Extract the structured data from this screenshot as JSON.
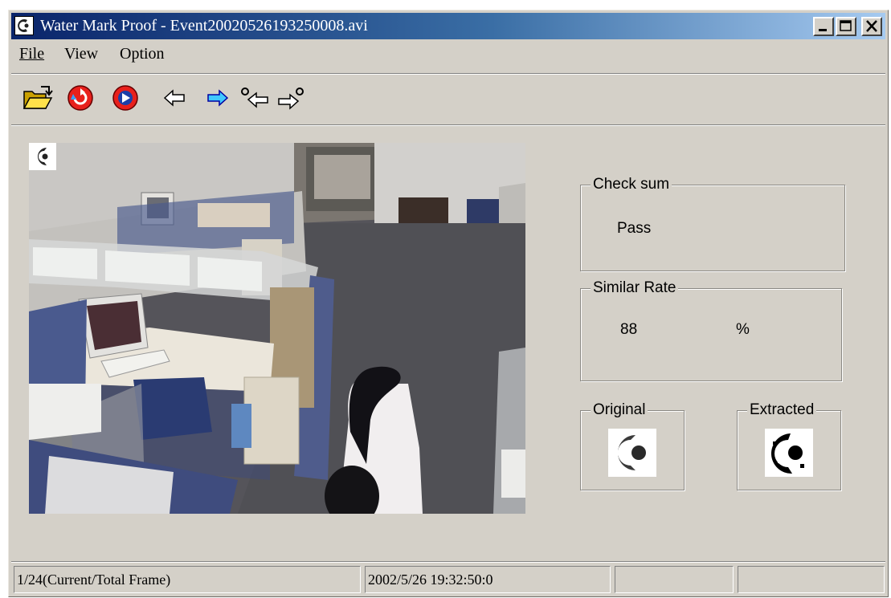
{
  "window": {
    "title": "Water Mark Proof - Event20020526193250008.avi",
    "controls": [
      "minimize-icon",
      "maximize-icon",
      "close-icon"
    ]
  },
  "menu": {
    "items": [
      {
        "label": "File",
        "mnemonic": "F"
      },
      {
        "label": "View"
      },
      {
        "label": "Option"
      }
    ]
  },
  "toolbar": {
    "buttons": [
      {
        "icon": "open-folder-icon"
      },
      {
        "icon": "rewind-icon"
      },
      {
        "icon": "play-icon"
      },
      {
        "icon": "previous-frame-icon"
      },
      {
        "icon": "next-frame-icon"
      },
      {
        "icon": "previous-watermark-icon"
      },
      {
        "icon": "next-watermark-icon"
      }
    ]
  },
  "panels": {
    "checksum": {
      "label": "Check sum",
      "value": "Pass"
    },
    "similar_rate": {
      "label": "Similar Rate",
      "value": "88",
      "unit": "%"
    },
    "original": {
      "label": "Original"
    },
    "extracted": {
      "label": "Extracted"
    }
  },
  "status": {
    "frame": "1/24(Current/Total Frame)",
    "timestamp": "2002/5/26 19:32:50:0",
    "pane3": "",
    "pane4": ""
  },
  "colors": {
    "title_gradient_start": "#0a246a",
    "title_gradient_end": "#a6caf0",
    "face": "#d4d0c8"
  }
}
